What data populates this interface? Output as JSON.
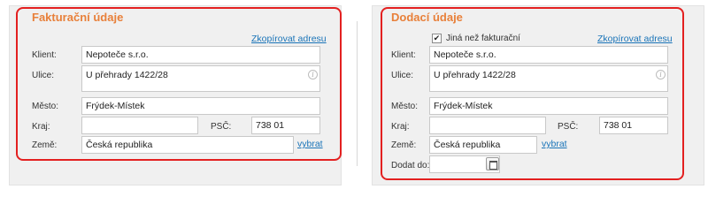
{
  "billing": {
    "title": "Fakturační údaje",
    "copy_address_link": "Zkopírovat adresu",
    "client_label": "Klient:",
    "client_value": "Nepoteče s.r.o.",
    "street_label": "Ulice:",
    "street_value": "U přehrady 1422/28",
    "city_label": "Město:",
    "city_value": "Frýdek-Místek",
    "region_label": "Kraj:",
    "region_value": "",
    "zip_label": "PSČ:",
    "zip_value": "738 01",
    "country_label": "Země:",
    "country_value": "Česká republika",
    "choose_link": "vybrat"
  },
  "delivery": {
    "title": "Dodací údaje",
    "different_checkbox_label": "Jiná než fakturační",
    "different_checked": true,
    "copy_address_link": "Zkopírovat adresu",
    "client_label": "Klient:",
    "client_value": "Nepoteče s.r.o.",
    "street_label": "Ulice:",
    "street_value": "U přehrady 1422/28",
    "city_label": "Město:",
    "city_value": "Frýdek-Místek",
    "region_label": "Kraj:",
    "region_value": "",
    "zip_label": "PSČ:",
    "zip_value": "738 01",
    "country_label": "Země:",
    "country_value": "Česká republika",
    "choose_link": "vybrat",
    "deliver_by_label": "Dodat do:",
    "deliver_by_value": ""
  },
  "icons": {
    "info": "info-icon",
    "calendar": "calendar-icon",
    "check": "checkbox-check"
  },
  "colors": {
    "title_orange": "#e8803a",
    "link_blue": "#1a74b8",
    "highlight_red": "#e32020",
    "panel_bg": "#f0f0f0"
  }
}
